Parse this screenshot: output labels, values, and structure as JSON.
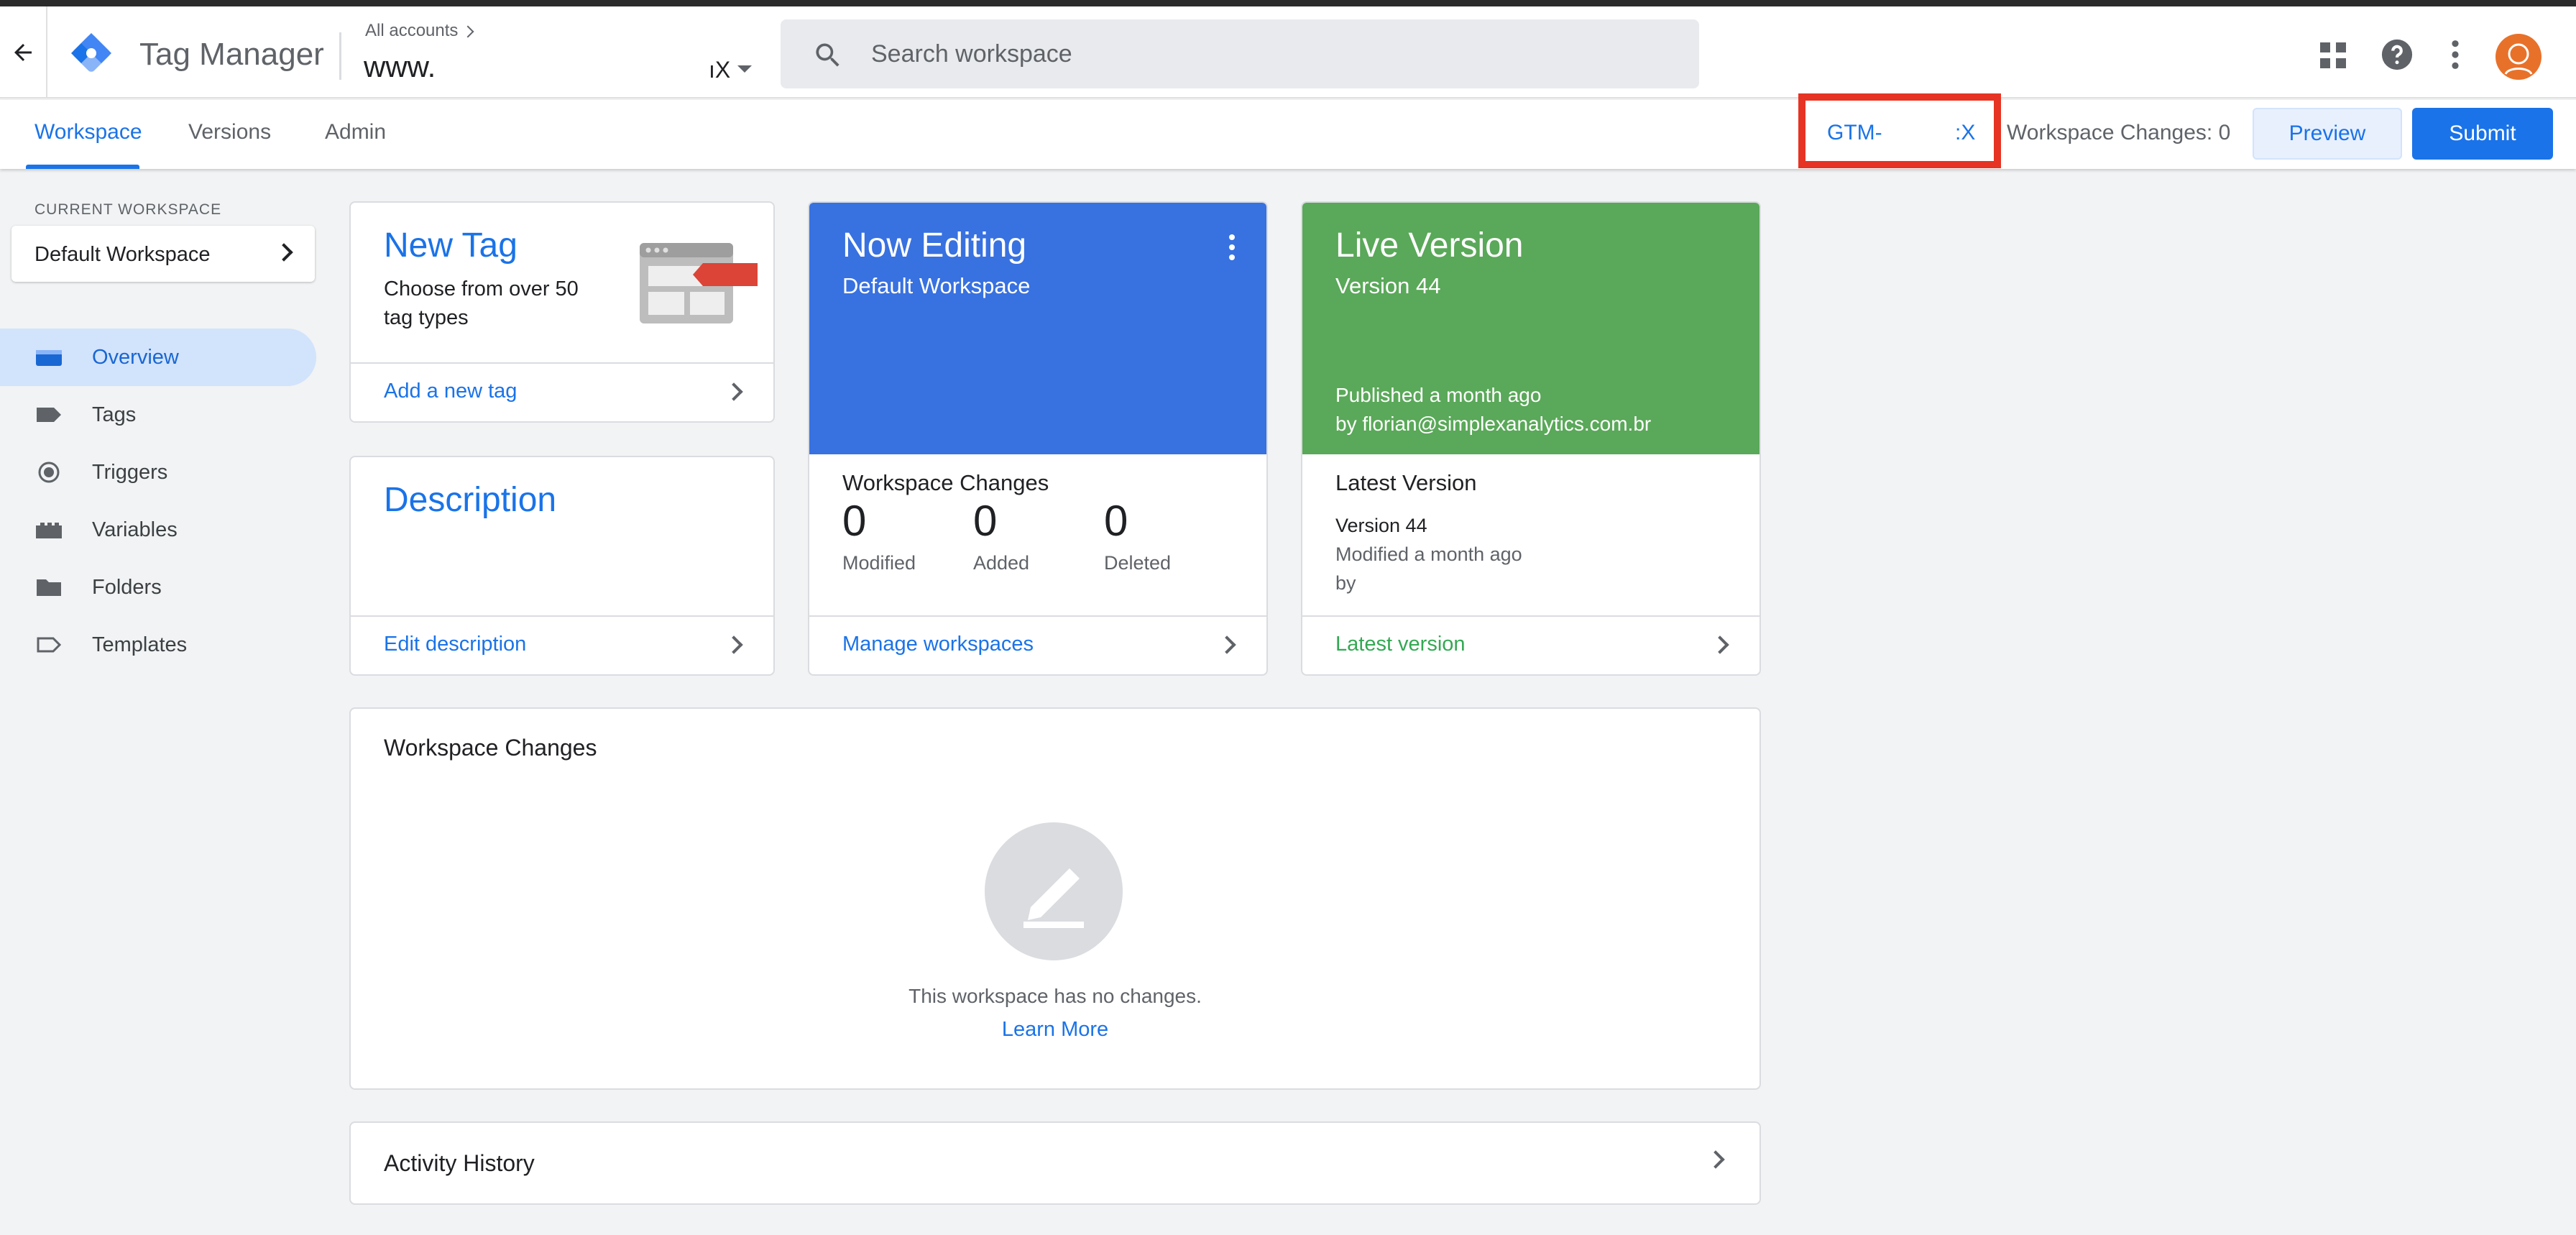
{
  "header": {
    "app_title": "Tag Manager",
    "all_accounts": "All accounts",
    "container_name": "www.",
    "container_suffix": "ıX",
    "search_placeholder": "Search workspace",
    "icons": [
      "back-arrow-icon",
      "gtm-logo-icon",
      "dropdown-arrow-icon",
      "search-icon",
      "apps-grid-icon",
      "help-icon",
      "more-vert-icon",
      "avatar"
    ]
  },
  "tabs": [
    {
      "label": "Workspace",
      "active": true
    },
    {
      "label": "Versions",
      "active": false
    },
    {
      "label": "Admin",
      "active": false
    }
  ],
  "container_id": {
    "prefix": "GTM-",
    "suffix": ":X",
    "highlight_color": "#e63323"
  },
  "workspace_changes_label": "Workspace Changes: 0",
  "buttons": {
    "preview": "Preview",
    "submit": "Submit"
  },
  "sidebar": {
    "current_workspace_label": "CURRENT WORKSPACE",
    "current_workspace": "Default Workspace",
    "items": [
      {
        "label": "Overview",
        "icon": "overview-icon",
        "active": true
      },
      {
        "label": "Tags",
        "icon": "tag-icon",
        "active": false
      },
      {
        "label": "Triggers",
        "icon": "trigger-icon",
        "active": false
      },
      {
        "label": "Variables",
        "icon": "variables-icon",
        "active": false
      },
      {
        "label": "Folders",
        "icon": "folder-icon",
        "active": false
      },
      {
        "label": "Templates",
        "icon": "templates-icon",
        "active": false
      }
    ]
  },
  "new_tag": {
    "title": "New Tag",
    "description": "Choose from over 50 tag types",
    "link": "Add a new tag"
  },
  "description_card": {
    "title": "Description",
    "link": "Edit description"
  },
  "now_editing": {
    "title": "Now Editing",
    "subtitle": "Default Workspace",
    "changes_title": "Workspace Changes",
    "stats": [
      {
        "value": "0",
        "label": "Modified"
      },
      {
        "value": "0",
        "label": "Added"
      },
      {
        "value": "0",
        "label": "Deleted"
      }
    ],
    "link": "Manage workspaces",
    "color": "#3871e0"
  },
  "live_version": {
    "title": "Live Version",
    "subtitle": "Version 44",
    "published": "Published a month ago",
    "published_by": "by florian@simplexanalytics.com.br",
    "latest_title": "Latest Version",
    "latest_version": "Version 44",
    "latest_modified": "Modified a month ago",
    "latest_by": "by",
    "link": "Latest version",
    "color": "#5aa859"
  },
  "workspace_changes_section": {
    "title": "Workspace Changes",
    "empty_text": "This workspace has no changes.",
    "learn_more": "Learn More"
  },
  "activity_history": {
    "title": "Activity History"
  }
}
